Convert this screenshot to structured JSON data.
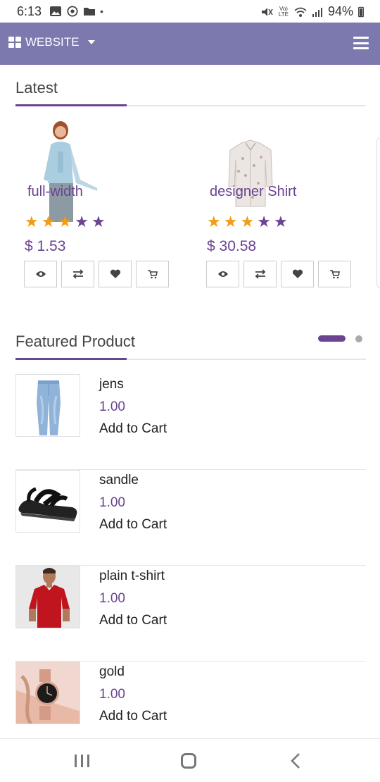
{
  "status_bar": {
    "time": "6:13",
    "battery": "94%",
    "network": "Vo) LTE"
  },
  "appbar": {
    "brand_label": "WEBSITE",
    "brand_icon": "grid-icon",
    "menu_icon": "hamburger-icon"
  },
  "latest": {
    "title": "Latest",
    "products": [
      {
        "name": "full-width",
        "price": "$ 1.53",
        "rating": 3,
        "max_rating": 5
      },
      {
        "name": "designer Shirt",
        "price": "$ 30.58",
        "rating": 3,
        "max_rating": 5
      }
    ],
    "action_icons": [
      "eye-icon",
      "compare-icon",
      "heart-icon",
      "cart-icon"
    ]
  },
  "featured": {
    "title": "Featured Product",
    "items": [
      {
        "name": "jens",
        "price": "1.00",
        "cart_label": "Add to Cart"
      },
      {
        "name": "sandle",
        "price": "1.00",
        "cart_label": "Add to Cart"
      },
      {
        "name": "plain t-shirt",
        "price": "1.00",
        "cart_label": "Add to Cart"
      },
      {
        "name": "gold",
        "price": "1.00",
        "cart_label": "Add to Cart"
      }
    ]
  },
  "colors": {
    "appbar": "#7b79ad",
    "accent": "#6a4391",
    "star": "#f39c12"
  }
}
